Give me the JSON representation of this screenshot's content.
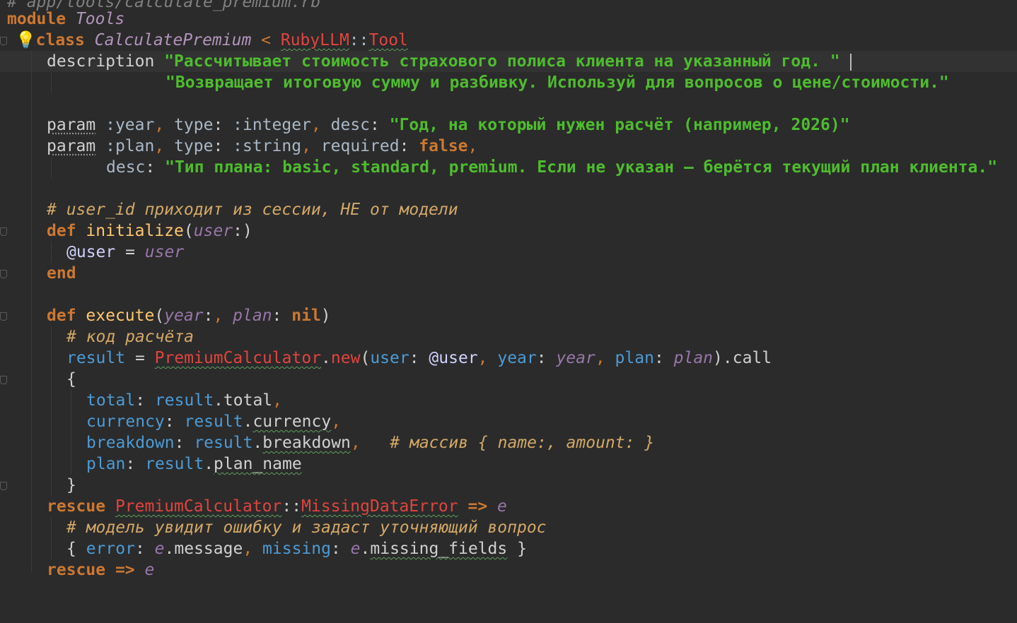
{
  "file_comment": "# app/tools/calculate_premium.rb",
  "lines": {
    "module_kw": "module",
    "module_name": "Tools",
    "class_kw": "class",
    "class_name": "CalculatePremium",
    "lt": " < ",
    "ruby_llm": "RubyLLM",
    "sep": "::",
    "tool": "Tool",
    "description_kw": "description",
    "desc_str1": "\"Рассчитывает стоимость страхового полиса клиента на указанный год. \"",
    "desc_str2": "\"Возвращает итоговую сумму и разбивку. Используй для вопросов о цене/стоимости.\"",
    "param_kw": "param",
    "year_sym": ":year",
    "type_key": "type",
    "integer_sym": ":integer",
    "desc_key": "desc",
    "year_desc": "\"Год, на который нужен расчёт (например, 2026)\"",
    "plan_sym": ":plan",
    "string_sym": ":string",
    "required_key": "required",
    "false_val": "false",
    "plan_desc": "\"Тип плана: basic, standard, premium. Если не указан — берётся текущий план клиента.\"",
    "comment_user_id": "# user_id приходит из сессии, НЕ от модели",
    "def_kw": "def",
    "initialize": "initialize",
    "user_param": "user",
    "ivar_user": "@user",
    "eq": " = ",
    "end_kw": "end",
    "execute": "execute",
    "year_param": "year",
    "plan_param": "plan",
    "nil_kw": "nil",
    "comment_calc": "# код расчёта",
    "result_var": "result",
    "premium_calc": "PremiumCalculator",
    "new_meth": "new",
    "user_key": "user",
    "year_key": "year",
    "plan_key": "plan",
    "call_meth": "call",
    "open_brace": "{",
    "close_brace": "}",
    "total_key": "total",
    "total_meth": "total",
    "currency_key": "currency",
    "currency_meth": "currency",
    "breakdown_key": "breakdown",
    "breakdown_meth": "breakdown",
    "comment_array": "# массив { name:, amount: }",
    "plan_key2": "plan",
    "plan_name_meth": "plan_name",
    "rescue_kw": "rescue",
    "missing_err": "MissingDataError",
    "arrow": "=>",
    "e_var": "e",
    "comment_model": "# модель увидит ошибку и задаст уточняющий вопрос",
    "error_key": "error",
    "message_meth": "message",
    "missing_key": "missing",
    "missing_fields_meth": "missing_fields"
  }
}
